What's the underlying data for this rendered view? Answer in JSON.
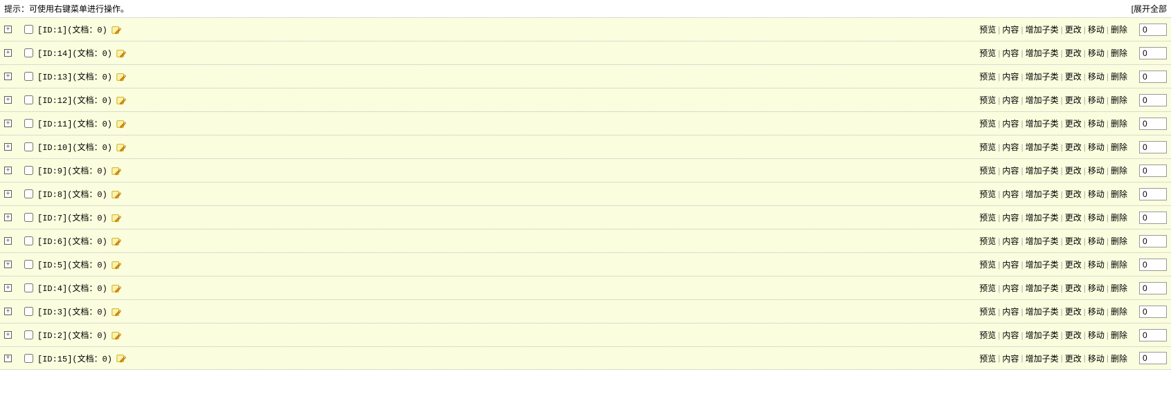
{
  "header": {
    "hint": "提示：可使用右键菜单进行操作。",
    "expand_all": "[展开全部"
  },
  "actions": {
    "preview": "预览",
    "content": "内容",
    "add_sub": "增加子类",
    "modify": "更改",
    "move": "移动",
    "delete": "删除"
  },
  "rows": [
    {
      "id": "1",
      "label": "[ID:1](文档：0)",
      "order": "0"
    },
    {
      "id": "14",
      "label": "[ID:14](文档：0)",
      "order": "0"
    },
    {
      "id": "13",
      "label": "[ID:13](文档：0)",
      "order": "0"
    },
    {
      "id": "12",
      "label": "[ID:12](文档：0)",
      "order": "0"
    },
    {
      "id": "11",
      "label": "[ID:11](文档：0)",
      "order": "0"
    },
    {
      "id": "10",
      "label": "[ID:10](文档：0)",
      "order": "0"
    },
    {
      "id": "9",
      "label": "[ID:9](文档：0)",
      "order": "0"
    },
    {
      "id": "8",
      "label": "[ID:8](文档：0)",
      "order": "0"
    },
    {
      "id": "7",
      "label": "[ID:7](文档：0)",
      "order": "0"
    },
    {
      "id": "6",
      "label": "[ID:6](文档：0)",
      "order": "0"
    },
    {
      "id": "5",
      "label": "[ID:5](文档：0)",
      "order": "0"
    },
    {
      "id": "4",
      "label": "[ID:4](文档：0)",
      "order": "0"
    },
    {
      "id": "3",
      "label": "[ID:3](文档：0)",
      "order": "0"
    },
    {
      "id": "2",
      "label": "[ID:2](文档：0)",
      "order": "0"
    },
    {
      "id": "15",
      "label": "[ID:15](文档：0)",
      "order": "0"
    }
  ]
}
